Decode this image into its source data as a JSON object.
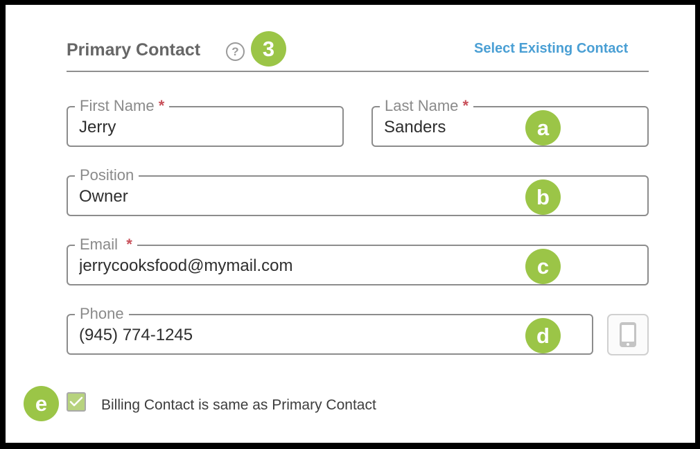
{
  "header": {
    "title": "Primary Contact",
    "help_icon": "question-circle-icon",
    "help_glyph": "?",
    "select_existing_label": "Select Existing Contact"
  },
  "fields": {
    "first_name": {
      "label": "First Name",
      "required_mark": "*",
      "value": "Jerry"
    },
    "last_name": {
      "label": "Last Name",
      "required_mark": "*",
      "value": "Sanders"
    },
    "position": {
      "label": "Position",
      "value": "Owner"
    },
    "email": {
      "label": "Email",
      "required_mark": "*",
      "value": "jerrycooksfood@mymail.com"
    },
    "phone": {
      "label": "Phone",
      "value": "(945) 774-1245"
    }
  },
  "mobile_button": {
    "icon": "mobile-phone-icon"
  },
  "billing": {
    "checked": true,
    "label": "Billing Contact is same as Primary Contact"
  },
  "callouts": {
    "step": "3",
    "a": "a",
    "b": "b",
    "c": "c",
    "d": "d",
    "e": "e"
  },
  "colors": {
    "callout_green": "#9bc547",
    "link_blue": "#4a9fd4",
    "required_red": "#c8505a",
    "checkbox_fill": "#b7d37e"
  }
}
